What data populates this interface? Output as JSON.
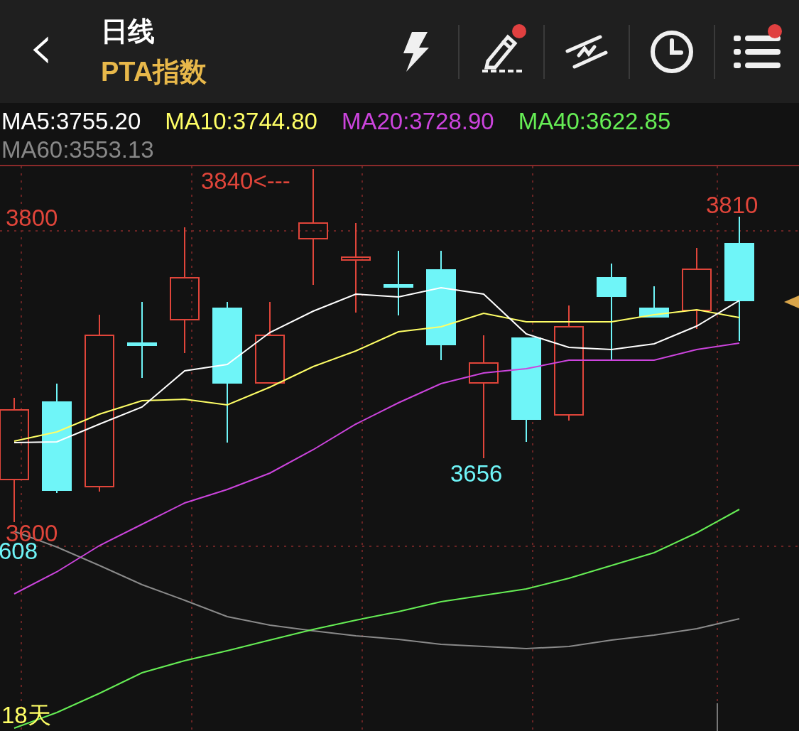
{
  "header": {
    "back": "‹",
    "title": "日线",
    "subtitle": "PTA指数"
  },
  "toolbar": [
    {
      "kind": "lightning",
      "badge": false
    },
    {
      "kind": "pencil",
      "badge": true
    },
    {
      "kind": "lines",
      "badge": false
    },
    {
      "kind": "clock",
      "badge": false
    },
    {
      "kind": "menu",
      "badge": true
    }
  ],
  "ma_legend": [
    {
      "label": "MA5:3755.20",
      "color": "#ffffff"
    },
    {
      "label": "MA10:3744.80",
      "color": "#ffff66"
    },
    {
      "label": "MA20:3728.90",
      "color": "#cc44dd"
    },
    {
      "label": "MA40:3622.85",
      "color": "#66ee55"
    },
    {
      "label": "MA60:3553.13",
      "color": "#888888"
    }
  ],
  "chart": {
    "marks": [
      {
        "text": "3840<---",
        "kind": "high"
      },
      {
        "text": "3800",
        "kind": "grid_top"
      },
      {
        "text": "3810",
        "kind": "last_high"
      },
      {
        "text": "3656",
        "kind": "low"
      },
      {
        "text": "3600",
        "kind": "grid_bottom"
      },
      {
        "text": "608",
        "kind": "left_low"
      },
      {
        "text": "18天",
        "kind": "period"
      }
    ]
  }
}
